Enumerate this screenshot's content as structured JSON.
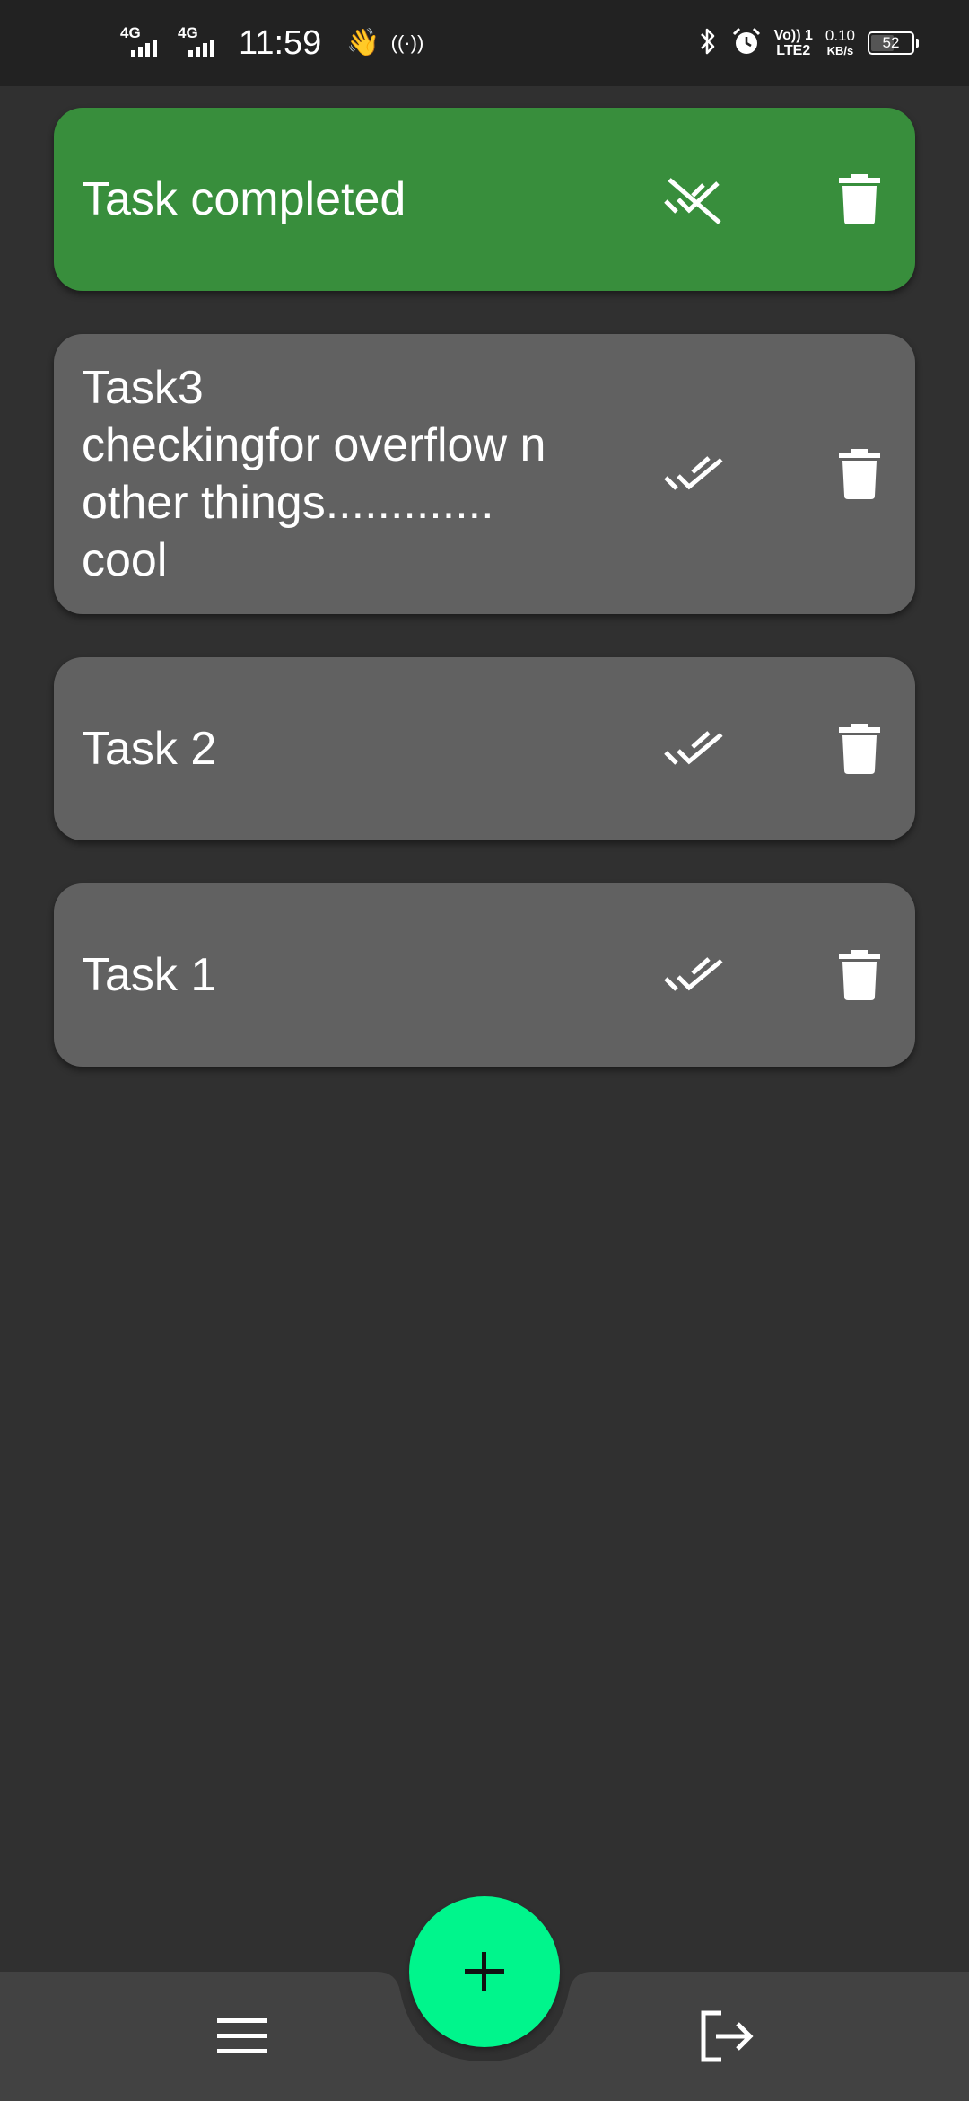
{
  "status_bar": {
    "network_1": "4G",
    "network_2": "4G",
    "time": "11:59",
    "wave_emoji": "👋",
    "hotspot": "((·))",
    "volte_top": "Vo)) 1",
    "volte_bottom": "LTE2",
    "speed_value": "0.10",
    "speed_unit": "KB/s",
    "battery_level": "52",
    "icons": [
      "bluetooth-icon",
      "alarm-icon"
    ]
  },
  "tasks": [
    {
      "text": "Task completed",
      "completed": true,
      "check_icon": "remove-done-icon",
      "delete_icon": "trash-icon"
    },
    {
      "text": "Task3\ncheckingfor overflow n\nother things.............\ncool",
      "completed": false,
      "check_icon": "done-all-icon",
      "delete_icon": "trash-icon"
    },
    {
      "text": "Task 2",
      "completed": false,
      "check_icon": "done-all-icon",
      "delete_icon": "trash-icon"
    },
    {
      "text": "Task 1",
      "completed": false,
      "check_icon": "done-all-icon",
      "delete_icon": "trash-icon"
    }
  ],
  "bottom_bar": {
    "menu_icon": "menu-icon",
    "fab_icon": "plus-icon",
    "logout_icon": "logout-icon"
  },
  "colors": {
    "background": "#303030",
    "status_bar": "#222222",
    "card": "#616161",
    "card_completed": "#388e3c",
    "bottom_bar": "#424242",
    "fab": "#00f58c",
    "icon": "#ffffff"
  }
}
